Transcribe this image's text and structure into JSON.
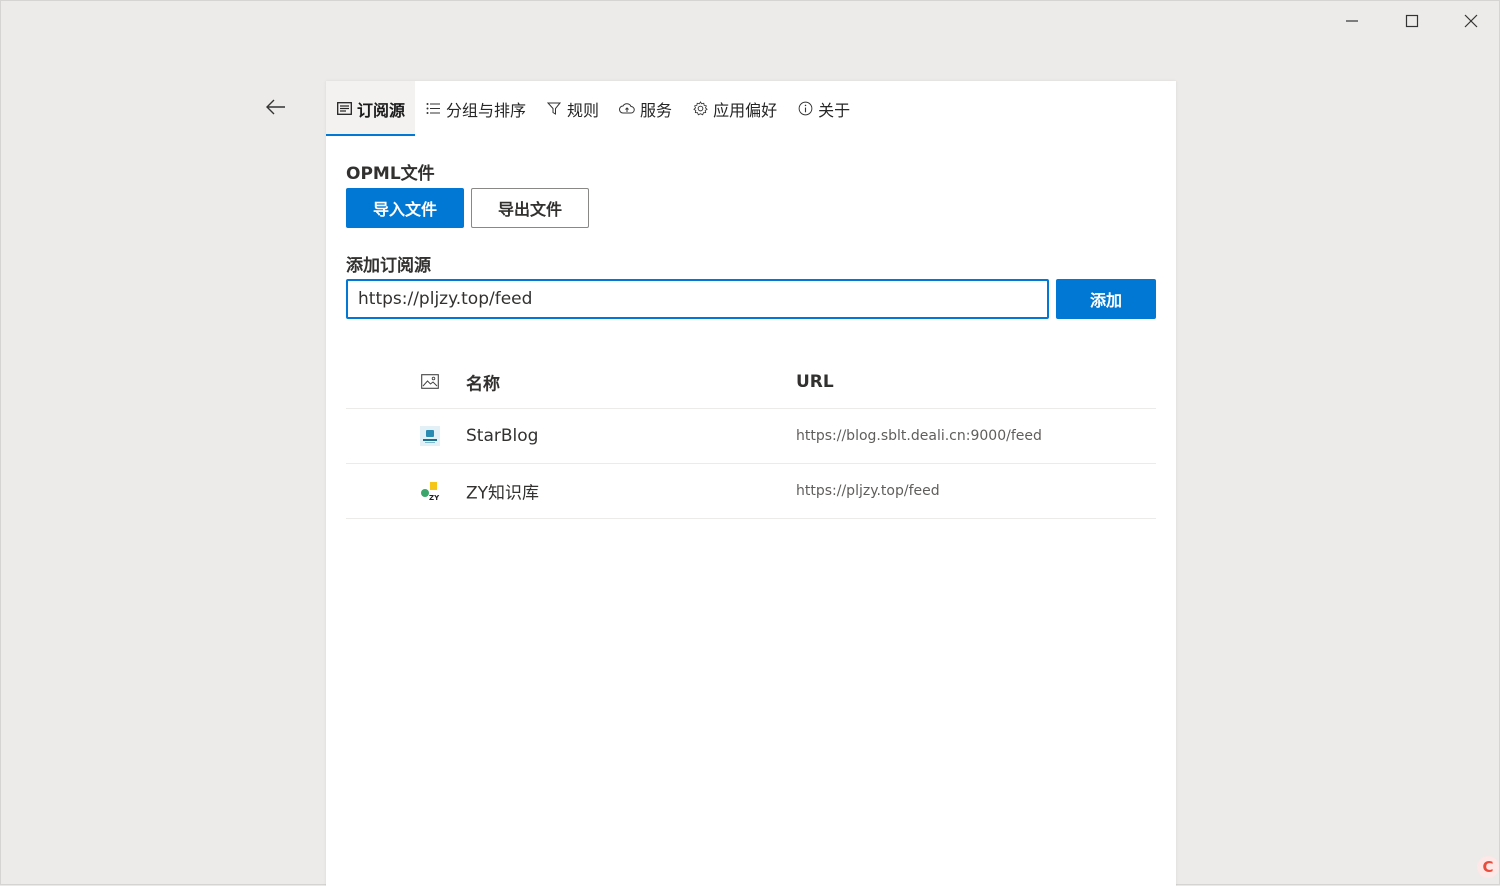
{
  "window": {
    "controls": {
      "minimize_icon": "minimize-icon",
      "maximize_icon": "maximize-icon",
      "close_icon": "close-icon"
    },
    "back_icon": "arrow-left-icon"
  },
  "tabs": [
    {
      "label": "订阅源",
      "icon": "feed-icon",
      "active": true
    },
    {
      "label": "分组与排序",
      "icon": "list-icon",
      "active": false
    },
    {
      "label": "规则",
      "icon": "filter-icon",
      "active": false
    },
    {
      "label": "服务",
      "icon": "cloud-sync-icon",
      "active": false
    },
    {
      "label": "应用偏好",
      "icon": "gear-icon",
      "active": false
    },
    {
      "label": "关于",
      "icon": "info-icon",
      "active": false
    }
  ],
  "opml": {
    "label": "OPML文件",
    "import_label": "导入文件",
    "export_label": "导出文件"
  },
  "add_source": {
    "label": "添加订阅源",
    "input_value": "https://pljzy.top/feed",
    "add_label": "添加"
  },
  "table": {
    "header": {
      "icon": "image-icon",
      "name": "名称",
      "url": "URL"
    },
    "rows": [
      {
        "icon": "starblog-favicon",
        "name": "StarBlog",
        "url": "https://blog.sblt.deali.cn:9000/feed"
      },
      {
        "icon": "zy-favicon",
        "name": "ZY知识库",
        "url": "https://pljzy.top/feed"
      }
    ]
  },
  "colors": {
    "accent": "#0078d4",
    "background": "#edebe9",
    "panel": "#ffffff"
  }
}
